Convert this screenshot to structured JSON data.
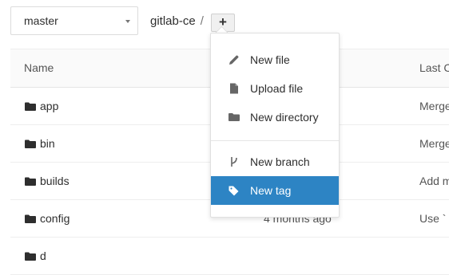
{
  "branch": {
    "selected": "master"
  },
  "breadcrumb": {
    "project": "gitlab-ce",
    "separator": "/"
  },
  "add_button": {
    "label": "+"
  },
  "table": {
    "headers": {
      "name": "Name",
      "last_commit": "Last C"
    },
    "rows": [
      {
        "name": "app",
        "date": "",
        "message": "Merge"
      },
      {
        "name": "bin",
        "date": "",
        "message": "Merge"
      },
      {
        "name": "builds",
        "date": "",
        "message": "Add m"
      },
      {
        "name": "config",
        "date": "4 months ago",
        "message": "Use `"
      },
      {
        "name": "d",
        "date": "",
        "message": ""
      }
    ]
  },
  "dropdown": {
    "items": [
      {
        "label": "New file",
        "icon": "pencil-icon"
      },
      {
        "label": "Upload file",
        "icon": "file-icon"
      },
      {
        "label": "New directory",
        "icon": "folder-icon"
      },
      {
        "label": "New branch",
        "icon": "code-fork-icon"
      },
      {
        "label": "New tag",
        "icon": "tags-icon",
        "active": true
      }
    ]
  },
  "colors": {
    "accent": "#2d84c4",
    "header_bg": "#fafafa"
  }
}
